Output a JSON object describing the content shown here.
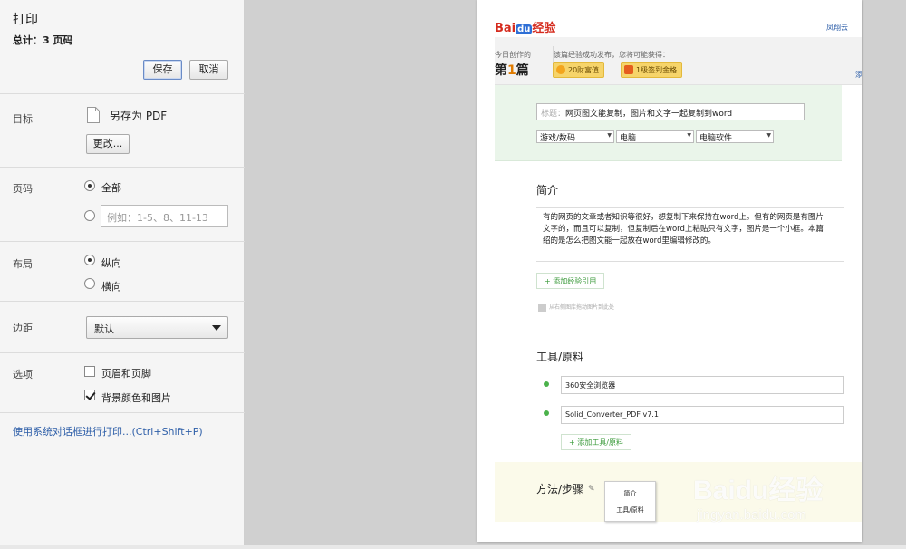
{
  "dialog": {
    "title": "打印",
    "total": "总计：3 页码",
    "save_label": "保存",
    "cancel_label": "取消"
  },
  "destination": {
    "label": "目标",
    "value": "另存为 PDF",
    "change_label": "更改..."
  },
  "pages": {
    "label": "页码",
    "all_label": "全部",
    "custom_placeholder": "例如：1-5、8、11-13"
  },
  "layout": {
    "label": "布局",
    "portrait_label": "纵向",
    "landscape_label": "横向"
  },
  "margins": {
    "label": "边距",
    "value": "默认"
  },
  "options": {
    "label": "选项",
    "header_footer_label": "页眉和页脚",
    "background_label": "背景颜色和图片"
  },
  "system_dialog_link": "使用系统对话框进行打印...(Ctrl+Shift+P)",
  "preview": {
    "logo_text": "Bai",
    "logo_paw": "du",
    "logo_cn": "经验",
    "top_link": "凤翔云",
    "today_label": "今日创作的",
    "rank_prefix": "第",
    "rank_number": "1",
    "rank_suffix": "篇",
    "reward_title": "该篇经验成功发布，您将可能获得：",
    "reward_1": "20财富值",
    "reward_2": "1级签到金格",
    "strip_link": "添",
    "title_prefix": "标题：",
    "title_value": "网页图文能复制，图片和文字一起复制到word",
    "category_1": "游戏/数码",
    "category_2": "电脑",
    "category_3": "电脑软件",
    "intro_heading": "简介",
    "intro_lines": [
      "有的网页的文章或者知识等很好，想复制下来保持在word上。但有的网页是有图片",
      "文字的，而且可以复制，但复制后在word上粘贴只有文字，图片是一个小框。本篇",
      "绍的是怎么把图文能一起放在word里编辑修改的。"
    ],
    "add_reference": "+ 添加经验引用",
    "drag_hint": "从右侧图库拖动图片到此处",
    "tools_heading": "工具/原料",
    "tool_1": "360安全浏览器",
    "tool_2": "Solid_Converter_PDF  v7.1",
    "add_tool": "+ 添加工具/原料",
    "steps_heading": "方法/步骤",
    "toc_1": "简介",
    "toc_2": "工具/原料"
  },
  "watermark": {
    "main": "Baidu经验",
    "sub": "jingyan.baidu.com"
  }
}
